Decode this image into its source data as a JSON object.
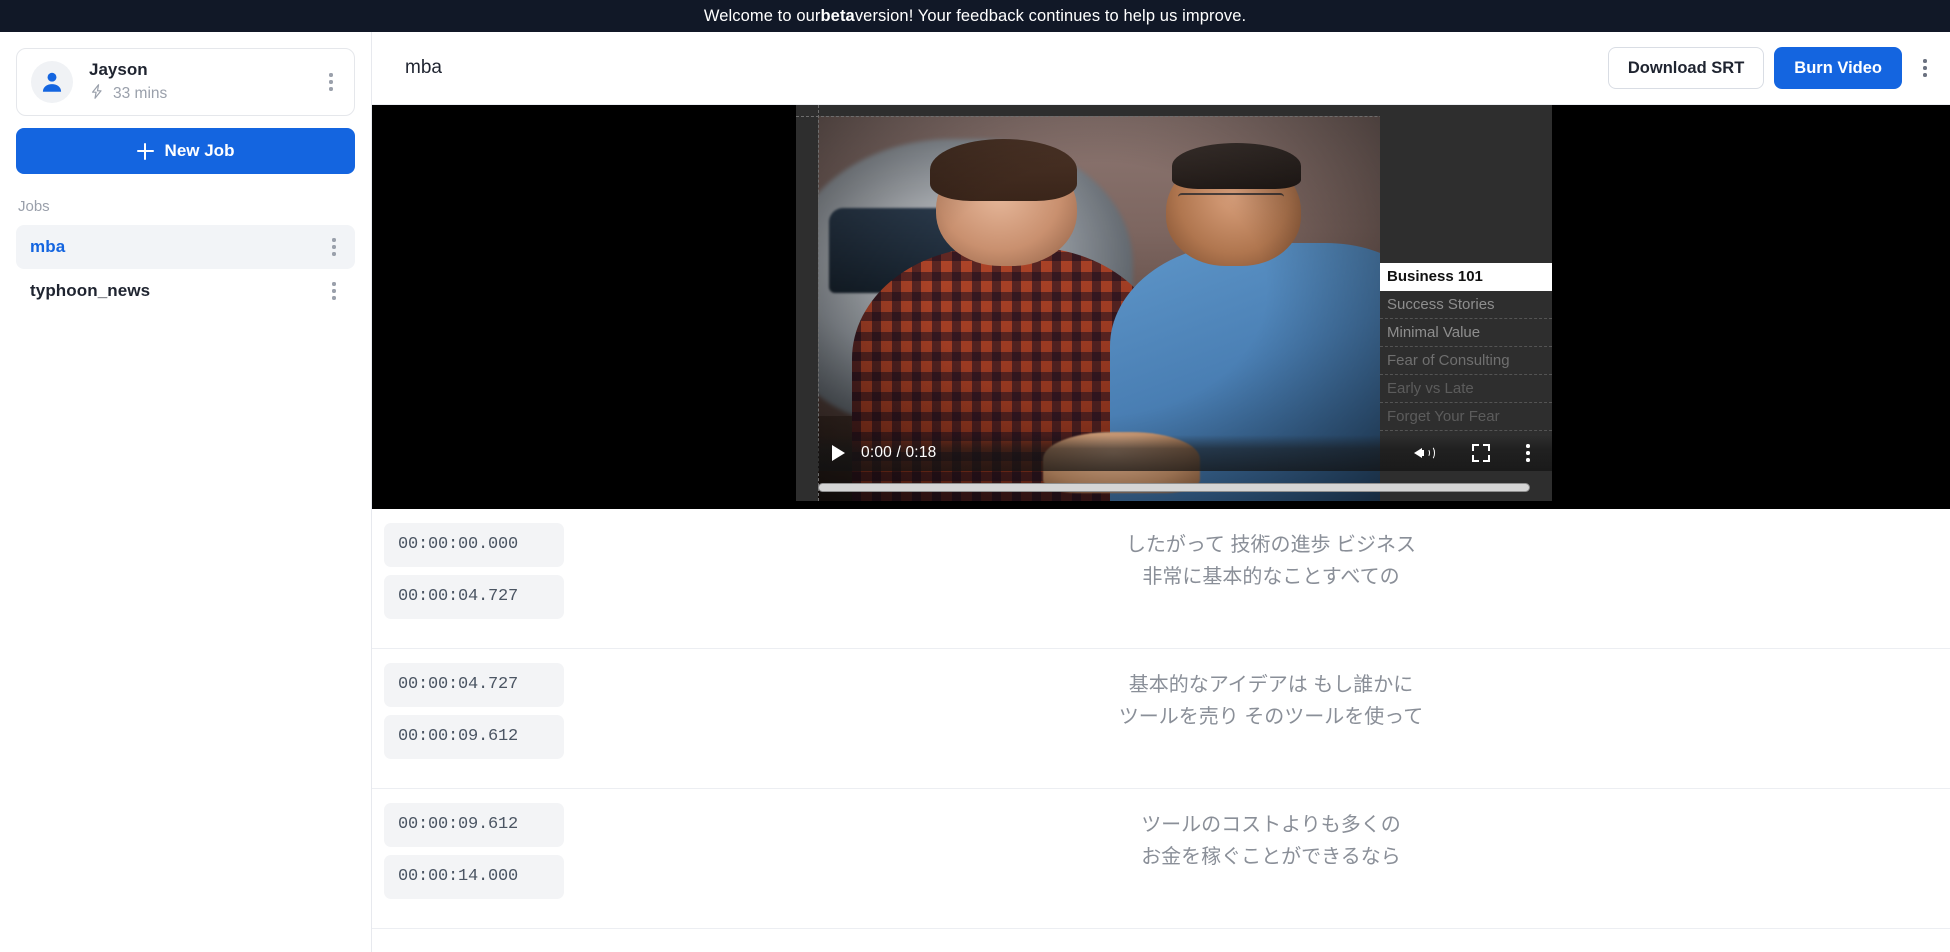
{
  "banner": {
    "prefix": "Welcome to our ",
    "bold": "beta",
    "suffix": " version! Your feedback continues to help us improve."
  },
  "sidebar": {
    "user": {
      "name": "Jayson",
      "credit": "33 mins",
      "credit_icon": "lightning-icon",
      "avatar_icon": "user-avatar-icon"
    },
    "new_job_label": "New Job",
    "jobs_label": "Jobs",
    "jobs": [
      {
        "name": "mba",
        "active": true
      },
      {
        "name": "typhoon_news",
        "active": false
      }
    ]
  },
  "topbar": {
    "title": "mba",
    "download_srt_label": "Download SRT",
    "burn_video_label": "Burn Video",
    "more_icon": "kebab-menu-icon"
  },
  "player": {
    "current_time": "0:00",
    "duration": "0:18",
    "time_display": "0:00 / 0:18",
    "play_icon": "play-icon",
    "volume_icon": "volume-icon",
    "fullscreen_icon": "fullscreen-icon",
    "options_icon": "kebab-menu-icon",
    "chapters": [
      {
        "label": "Business 101",
        "selected": true
      },
      {
        "label": "Success Stories",
        "selected": false
      },
      {
        "label": "Minimal Value",
        "selected": false
      },
      {
        "label": "Fear of Consulting",
        "selected": false
      },
      {
        "label": "Early vs Late",
        "selected": false
      },
      {
        "label": "Forget Your Fear",
        "selected": false
      }
    ]
  },
  "transcript": {
    "cues": [
      {
        "start": "00:00:00.000",
        "end": "00:00:04.727",
        "lines": [
          "したがって 技術の進歩 ビジネス",
          "非常に基本的なことすべての"
        ]
      },
      {
        "start": "00:00:04.727",
        "end": "00:00:09.612",
        "lines": [
          "基本的なアイデアは もし誰かに",
          "ツールを売り そのツールを使って"
        ]
      },
      {
        "start": "00:00:09.612",
        "end": "00:00:14.000",
        "lines": [
          "ツールのコストよりも多くの",
          "お金を稼ぐことができるなら"
        ]
      }
    ]
  },
  "colors": {
    "brand_blue": "#1465e0",
    "banner_bg": "#111827",
    "muted_text": "#8a8f98"
  }
}
